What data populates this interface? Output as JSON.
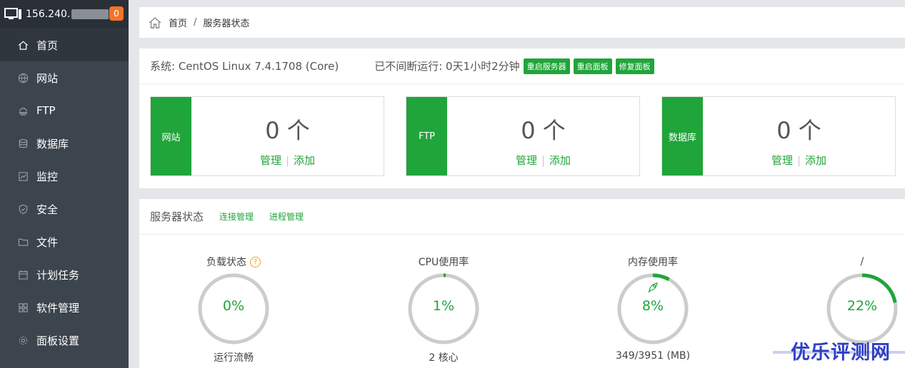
{
  "header": {
    "ip": "156.240.",
    "badge": "0"
  },
  "sidebar": {
    "items": [
      {
        "label": "首页",
        "icon": "home-icon",
        "active": true
      },
      {
        "label": "网站",
        "icon": "globe-icon"
      },
      {
        "label": "FTP",
        "icon": "ftp-icon"
      },
      {
        "label": "数据库",
        "icon": "database-icon"
      },
      {
        "label": "监控",
        "icon": "monitor-chart-icon"
      },
      {
        "label": "安全",
        "icon": "shield-icon"
      },
      {
        "label": "文件",
        "icon": "folder-icon"
      },
      {
        "label": "计划任务",
        "icon": "calendar-icon"
      },
      {
        "label": "软件管理",
        "icon": "apps-grid-icon"
      },
      {
        "label": "面板设置",
        "icon": "gear-icon"
      }
    ]
  },
  "breadcrumb": {
    "home": "首页",
    "sep": "/",
    "current": "服务器状态"
  },
  "system": {
    "os": "系统: CentOS Linux 7.4.1708 (Core)",
    "uptime": "已不间断运行: 0天1小时2分钟",
    "buttons": [
      "重启服务器",
      "重启面板",
      "修复面板"
    ]
  },
  "cards": [
    {
      "tag": "网站",
      "count": "0 个",
      "manage": "管理",
      "add": "添加"
    },
    {
      "tag": "FTP",
      "count": "0 个",
      "manage": "管理",
      "add": "添加"
    },
    {
      "tag": "数据库",
      "count": "0 个",
      "manage": "管理",
      "add": "添加"
    }
  ],
  "status": {
    "title": "服务器状态",
    "links": [
      "连接管理",
      "进程管理"
    ],
    "gauges": [
      {
        "label": "负载状态",
        "help": "?",
        "value": "0%",
        "percent": 0,
        "sub": "运行流畅"
      },
      {
        "label": "CPU使用率",
        "value": "1%",
        "percent": 1,
        "sub": "2 核心"
      },
      {
        "label": "内存使用率",
        "value": "8%",
        "percent": 8,
        "sub": "349/3951 (MB)"
      },
      {
        "label": "/",
        "value": "22%",
        "percent": 22,
        "sub": ""
      }
    ]
  },
  "watermark": "优乐评测网",
  "colors": {
    "accent": "#20a53a",
    "sidebar": "#3c444d",
    "badge": "#f57325",
    "track": "#cccccc"
  }
}
